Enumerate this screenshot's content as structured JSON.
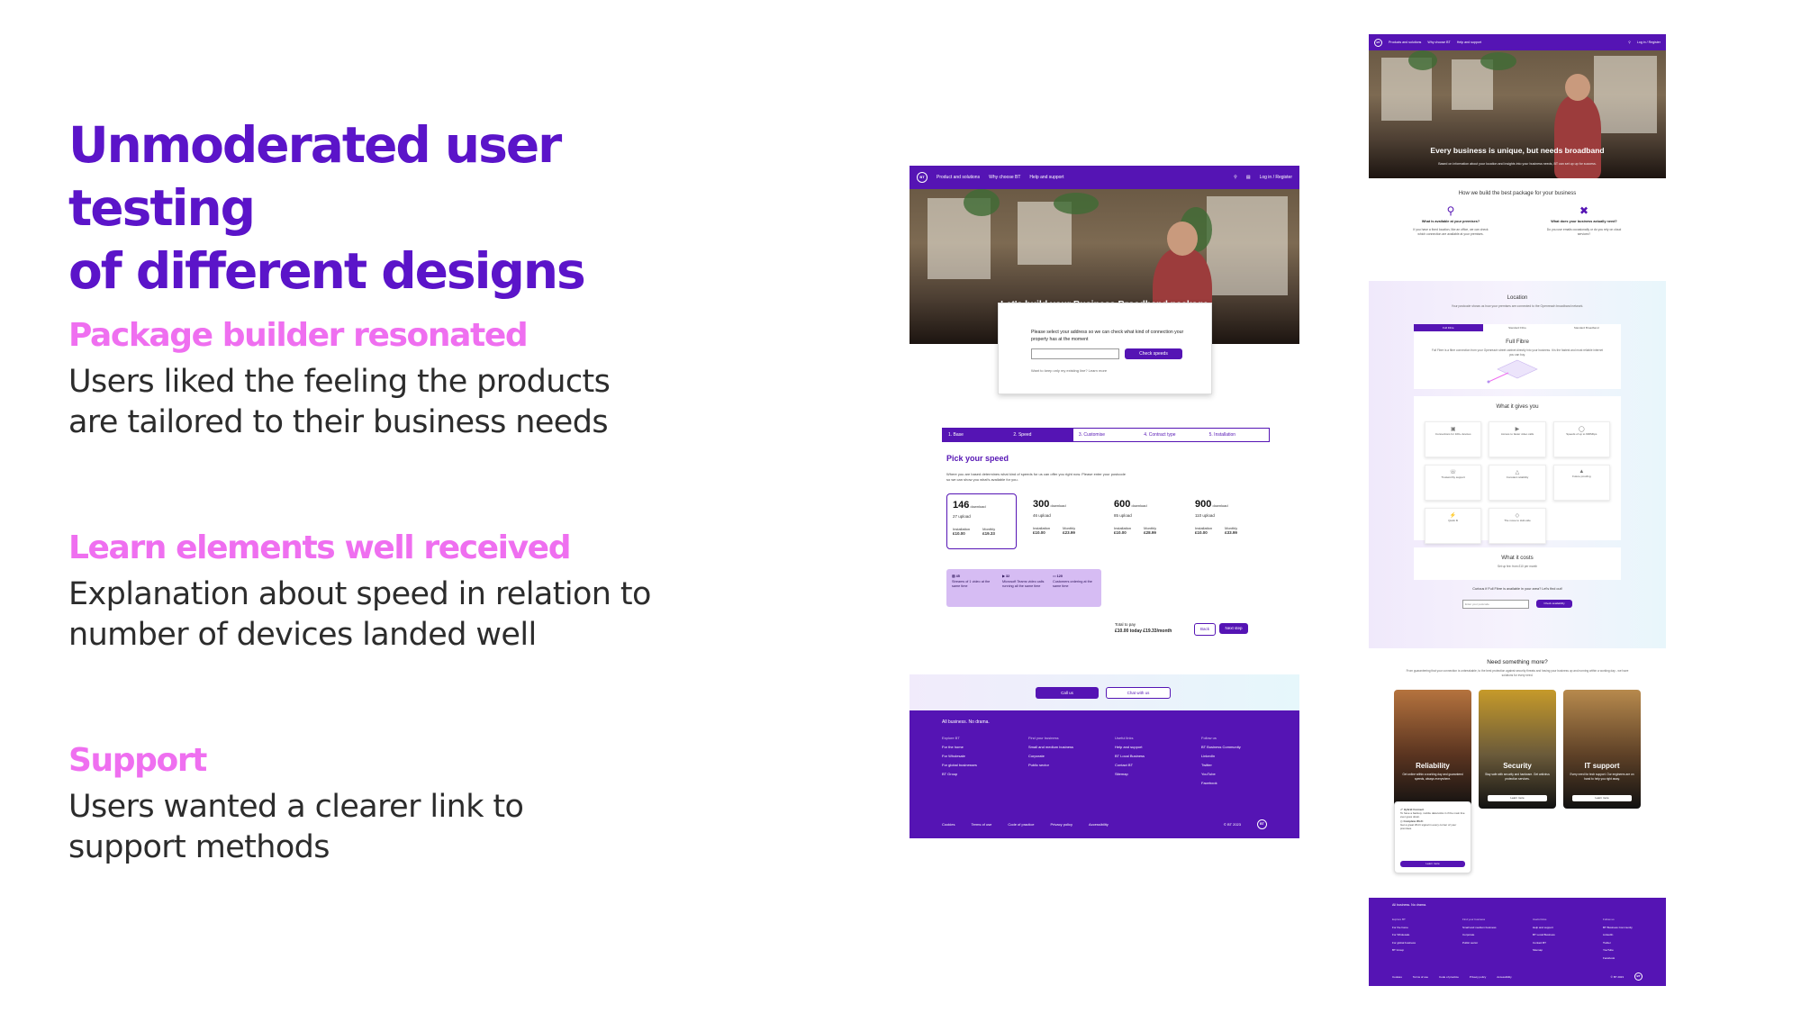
{
  "slide": {
    "title_line1": "Unmoderated user testing",
    "title_line2": "of different designs",
    "sections": [
      {
        "heading": "Package builder resonated",
        "line1": "Users liked the feeling the products",
        "line2": "are tailored to their business needs"
      },
      {
        "heading": "Learn elements well received",
        "line1": "Explanation about speed in relation to",
        "line2": "number of devices landed well"
      },
      {
        "heading": "Support",
        "line1": "Users wanted a clearer link to",
        "line2": "support methods"
      }
    ]
  },
  "colors": {
    "accent": "#5b14c9",
    "pink": "#ef6ff0",
    "brand": "#5514b4",
    "learn_bg": "#d6bcf3"
  },
  "design1": {
    "nav": {
      "logo": "BT",
      "links": [
        "Product and solutions",
        "Why choose BT",
        "Help and support"
      ],
      "search_icon": "search-icon",
      "basket_icon": "basket-icon",
      "login": "Log in / Register"
    },
    "hero_title": "Let's build your Business Broadband package",
    "address_card": {
      "question": "Please select your address so we can check what kind of connection your property has at the moment",
      "button": "Check speeds",
      "help": "Want to keep only my existing line? Learn more"
    },
    "steps": [
      "1. Base",
      "2. Speed",
      "3. Customise",
      "4. Contract type",
      "5. Installation"
    ],
    "pick_title": "Pick your speed",
    "pick_desc": "Where you are based determines what kind of speeds for us can offer you right now. Please enter your postcode so we can show you what's available for you.",
    "speeds": [
      {
        "n": "146",
        "dl": "download",
        "ul": "27 upload",
        "install_label": "Installation",
        "install": "£10.00",
        "monthly_label": "Monthly",
        "monthly": "£19.33"
      },
      {
        "n": "300",
        "dl": "download",
        "ul": "46 upload",
        "install_label": "Installation",
        "install": "£10.00",
        "monthly_label": "Monthly",
        "monthly": "£23.99"
      },
      {
        "n": "600",
        "dl": "download",
        "ul": "85 upload",
        "install_label": "Installation",
        "install": "£10.00",
        "monthly_label": "Monthly",
        "monthly": "£28.99"
      },
      {
        "n": "900",
        "dl": "download",
        "ul": "110 upload",
        "install_label": "Installation",
        "install": "£10.00",
        "monthly_label": "Monthly",
        "monthly": "£33.99"
      }
    ],
    "learn": [
      {
        "icon": "tv-icon",
        "count": "45",
        "text": "Streams of 1 video at the same time"
      },
      {
        "icon": "video-call-icon",
        "count": "32",
        "text": "Microsoft Teams video calls running all the same time"
      },
      {
        "icon": "card-icon",
        "count": "120",
        "text": "Customers ordering at the same time"
      }
    ],
    "total_label": "Total to pay",
    "total_today": "£10.00 today",
    "total_month": "£19.33/month",
    "back": "Back",
    "next": "Next step",
    "cta_call": "Call us",
    "cta_chat": "Chat with us",
    "footer": {
      "tagline": "All business. No drama.",
      "cols": [
        {
          "h": "Explore BT",
          "items": [
            "For the home",
            "For Wholesale",
            "For global businesses",
            "BT Group"
          ]
        },
        {
          "h": "Find your business",
          "items": [
            "Small and medium business",
            "Corporate",
            "Public sector"
          ]
        },
        {
          "h": "Useful links",
          "items": [
            "Help and support",
            "BT Local Business",
            "Contact BT",
            "Sitemap"
          ]
        },
        {
          "h": "Follow us",
          "items": [
            "BT Business Community",
            "LinkedIn",
            "Twitter",
            "YouTube",
            "Facebook"
          ]
        }
      ],
      "bottom": [
        "Cookies",
        "Terms of use",
        "Code of practice",
        "Privacy policy",
        "Accessibility"
      ],
      "copyright": "© BT 2023"
    }
  },
  "design2": {
    "nav": {
      "logo": "BT",
      "links": [
        "Products and solutions",
        "Why choose BT",
        "Help and support"
      ],
      "login": "Log in / Register"
    },
    "hero_title": "Every business is unique, but needs broadband",
    "hero_sub": "Based on information about your location and insights into your business needs, BT can set up up for success.",
    "how_title": "How we build the best package for your business",
    "how": [
      {
        "icon": "location-pin-icon",
        "h": "What is available at your premises?",
        "t": "If you have a fixed location, like an office, we can check which connection are available at your premises."
      },
      {
        "icon": "tools-icon",
        "h": "What does your business actually need?",
        "t": "Do you use emails occasionally or do you rely on cloud services?"
      }
    ],
    "location_title": "Location",
    "location_sub": "Your postcode shows us how your premises are connected to the Openreach broadband network.",
    "tabs": [
      "Full Fibre",
      "Standard Fibre",
      "Standard Broadband"
    ],
    "fibre_title": "Full Fibre",
    "fibre_desc": "Full Fibre is a fibre connection from your Openreach street cabinet directly into your business. It is the fastest and most reliable internet you can buy.",
    "gives_title": "What it gives you",
    "gives": [
      "Connections for 100+ devices",
      "Access to faster video calls",
      "Speeds of up to 900Mbps",
      "Trustworthy support",
      "Constant reliability",
      "Future proofing",
      "Quick fit",
      "The move to Hub-side"
    ],
    "works_title": "What it costs",
    "works_sub": "Set up fee: from £10 per month",
    "postcode_q": "Curious if Full Fibre is available in your area? Let's find out!",
    "postcode_placeholder": "Enter your postcode",
    "postcode_btn": "Check availability",
    "need_title": "Need something more?",
    "need_sub": "From guaranteeing that your connection is unbreakable, to the best protection against security threats and having your business up and running within a working day - we have solutions for every need.",
    "tiles": [
      {
        "label": "Reliability",
        "desc": "Get online within a working day and guaranteed speeds, always everywhere.",
        "btn": "Learn more"
      },
      {
        "label": "Security",
        "desc": "Stay safe with security and hardware. Get antivirus protection services.",
        "btn": "Learn more"
      },
      {
        "label": "IT support",
        "desc": "Every need for tech support. Our engineers are on hand to help you right away.",
        "btn": "Learn more"
      }
    ],
    "popup": {
      "h1": "Hybrid Connect",
      "t1": "To have a backup, mobile data kicks in if the main line ever goes down.",
      "h2": "Complete Wi-Fi",
      "t2": "Get a great Wi-Fi signal in every corner of your premises.",
      "btn": "Learn more"
    },
    "footer": {
      "tagline": "All business. No drama.",
      "cols": [
        {
          "h": "Explore BT",
          "items": [
            "For the home",
            "For Wholesale",
            "For global business",
            "BT Group"
          ]
        },
        {
          "h": "Find your business",
          "items": [
            "Small and medium business",
            "Corporate",
            "Public sector"
          ]
        },
        {
          "h": "Useful links",
          "items": [
            "Help and support",
            "BT Local Business",
            "Contact BT",
            "Sitemap"
          ]
        },
        {
          "h": "Follow us",
          "items": [
            "BT Business Community",
            "LinkedIn",
            "Twitter",
            "YouTube",
            "Facebook"
          ]
        }
      ],
      "bottom": [
        "Cookies",
        "Terms of use",
        "Code of practice",
        "Privacy policy",
        "Accessibility"
      ],
      "copyright": "© BT 2023"
    }
  }
}
